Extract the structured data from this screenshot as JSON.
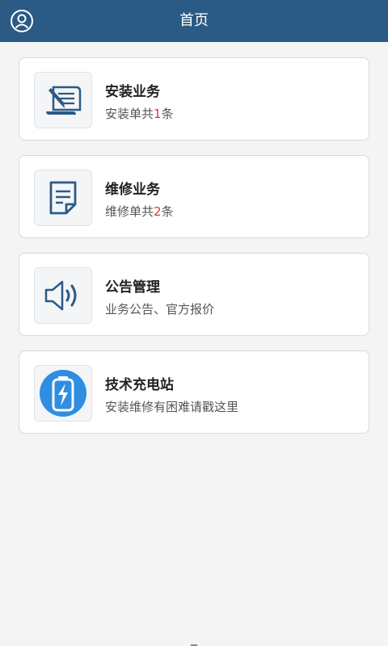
{
  "header": {
    "title": "首页",
    "user_icon": "user-icon",
    "bg_color": "#2b5a85"
  },
  "cards": [
    {
      "icon": "install-scroll-icon",
      "title": "安装业务",
      "desc_prefix": "安装单共",
      "count": "1",
      "desc_suffix": "条"
    },
    {
      "icon": "repair-document-icon",
      "title": "维修业务",
      "desc_prefix": "维修单共",
      "count": "2",
      "desc_suffix": "条"
    },
    {
      "icon": "speaker-icon",
      "title": "公告管理",
      "desc": "业务公告、官方报价"
    },
    {
      "icon": "battery-charge-icon",
      "title": "技术充电站",
      "desc": "安装维修有困难请戳这里"
    }
  ],
  "colors": {
    "accent": "#2b5a85",
    "count": "#d9373a",
    "battery": "#2f8ee0"
  }
}
